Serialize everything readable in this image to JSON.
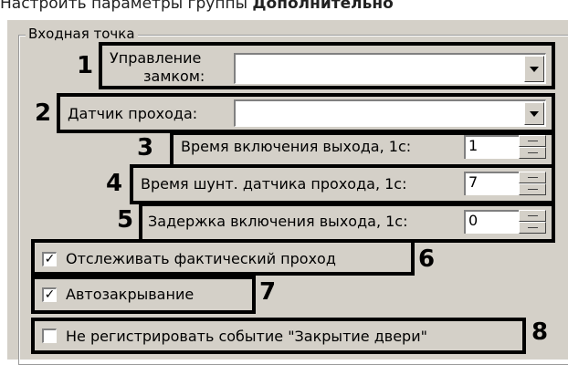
{
  "heading": {
    "prefix": "Настроить параметры группы ",
    "bold": "Дополнительно"
  },
  "group_title": "Входная точка",
  "lock_control": {
    "number": "1",
    "label_line1": "Управление",
    "label_line2": "замком:",
    "value": ""
  },
  "pass_sensor": {
    "number": "2",
    "label": "Датчик прохода:",
    "value": ""
  },
  "output_on_time": {
    "number": "3",
    "label": "Время включения выхода, 1с:",
    "value": "1"
  },
  "sensor_shunt_time": {
    "number": "4",
    "label": "Время шунт. датчика прохода, 1с:",
    "value": "7"
  },
  "output_delay": {
    "number": "5",
    "label": "Задержка включения выхода, 1с:",
    "value": "0"
  },
  "track_pass": {
    "number": "6",
    "label": "Отслеживать фактический проход",
    "checked": true
  },
  "auto_close": {
    "number": "7",
    "label": "Автозакрывание",
    "checked": true
  },
  "no_register_close": {
    "number": "8",
    "label": "Не регистрировать событие \"Закрытие двери\"",
    "checked": false
  },
  "icons": {
    "dropdown": "chevron-down-icon",
    "spinner": "spinner-icon",
    "checkbox": "checkmark-icon"
  }
}
